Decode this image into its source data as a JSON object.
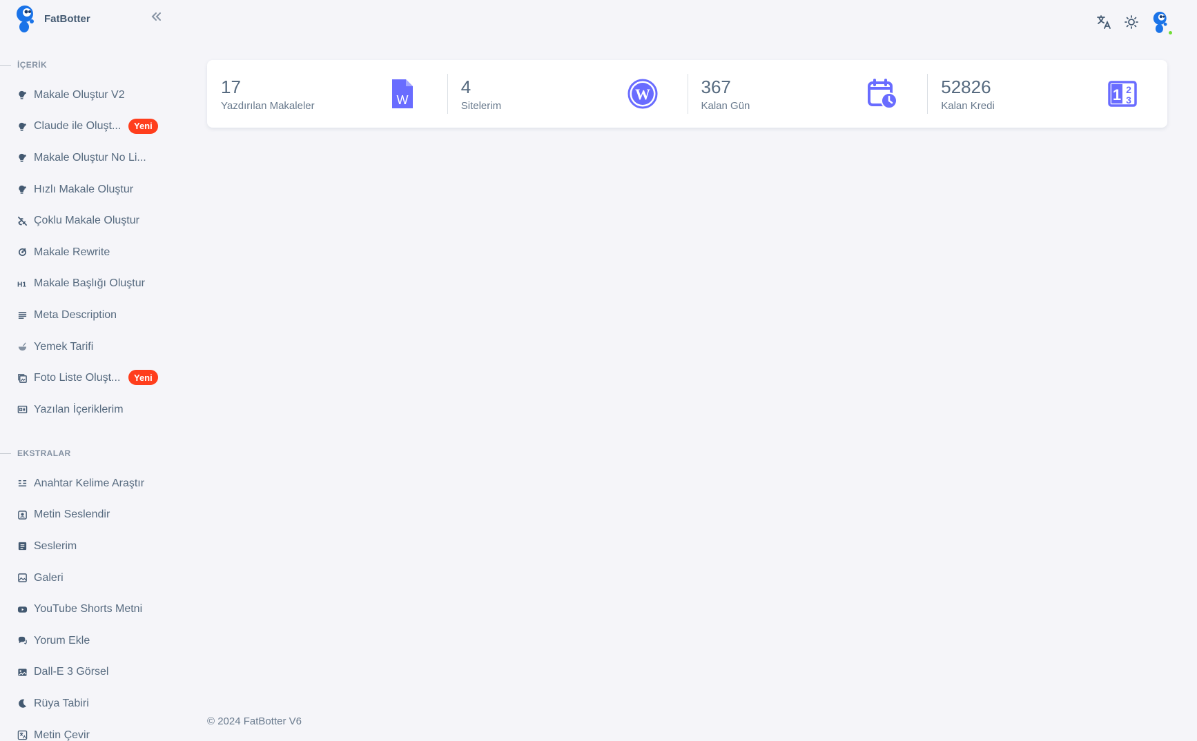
{
  "brand": {
    "name": "FatBotter"
  },
  "sidebar": {
    "section_content": "İÇERİK",
    "content_items": [
      {
        "label": "Makale Oluştur V2",
        "icon": "bulb-icon"
      },
      {
        "label": "Claude ile Oluşt...",
        "icon": "bulb-icon",
        "badge": "Yeni"
      },
      {
        "label": "Makale Oluştur No Li...",
        "icon": "bulb-icon"
      },
      {
        "label": "Hızlı Makale Oluştur",
        "icon": "bulb-icon"
      },
      {
        "label": "Çoklu Makale Oluştur",
        "icon": "link-off-icon"
      },
      {
        "label": "Makale Rewrite",
        "icon": "rotate-icon"
      },
      {
        "label": "Makale Başlığı Oluştur",
        "icon": "h1-icon"
      },
      {
        "label": "Meta Description",
        "icon": "lines-icon"
      },
      {
        "label": "Yemek Tarifi",
        "icon": "bowl-icon"
      },
      {
        "label": "Foto Liste Oluşt...",
        "icon": "photos-icon",
        "badge": "Yeni"
      },
      {
        "label": "Yazılan İçeriklerim",
        "icon": "news-icon"
      }
    ],
    "section_extras": "EKSTRALAR",
    "extra_items": [
      {
        "label": "Anahtar Kelime Araştır",
        "icon": "list-search-icon"
      },
      {
        "label": "Metin Seslendir",
        "icon": "voice-icon"
      },
      {
        "label": "Seslerim",
        "icon": "voice-list-icon"
      },
      {
        "label": "Galeri",
        "icon": "gallery-icon"
      },
      {
        "label": "YouTube Shorts Metni",
        "icon": "youtube-icon"
      },
      {
        "label": "Yorum Ekle",
        "icon": "comments-icon"
      },
      {
        "label": "Dall-E 3 Görsel",
        "icon": "image-icon"
      },
      {
        "label": "Rüya Tabiri",
        "icon": "moon-icon"
      },
      {
        "label": "Metin Çevir",
        "icon": "translate-icon"
      }
    ]
  },
  "stats": [
    {
      "value": "17",
      "label": "Yazdırılan Makaleler",
      "icon": "word-doc-icon"
    },
    {
      "value": "4",
      "label": "Sitelerim",
      "icon": "wordpress-icon"
    },
    {
      "value": "367",
      "label": "Kalan Gün",
      "icon": "calendar-clock-icon"
    },
    {
      "value": "52826",
      "label": "Kalan Kredi",
      "icon": "numbers-icon"
    }
  ],
  "footer": {
    "text": "© 2024 FatBotter V6"
  },
  "colors": {
    "accent": "#696cff",
    "badge": "#ff3e1d",
    "status": "#71dd37",
    "brand_blue": "#1a73e8"
  }
}
